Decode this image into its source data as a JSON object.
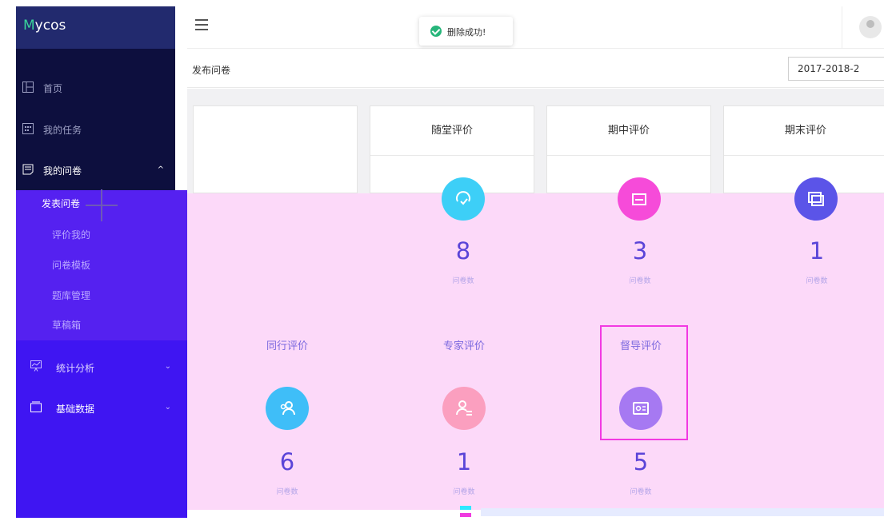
{
  "brand": {
    "first": "M",
    "rest": "ycos"
  },
  "sidebar": {
    "items": [
      {
        "label": "首页",
        "icon": "grid-icon"
      },
      {
        "label": "我的任务",
        "icon": "calendar-icon"
      },
      {
        "label": "我的问卷",
        "icon": "document-icon",
        "caret": "^"
      }
    ],
    "submenu": [
      {
        "label": "发表问卷"
      },
      {
        "label": "评价我的"
      },
      {
        "label": "问卷模板"
      },
      {
        "label": "题库管理"
      },
      {
        "label": "草稿箱"
      }
    ],
    "lower": [
      {
        "label": "统计分析",
        "icon": "chart-icon",
        "caret": "⌄"
      },
      {
        "label": "基础数据",
        "icon": "database-icon",
        "caret": "⌄"
      }
    ]
  },
  "header": {
    "toast": "删除成功!"
  },
  "breadcrumb": "发布问卷",
  "term": "2017-2018-2",
  "cards": [
    {
      "title": "随堂评价",
      "count": "8",
      "sub": "问卷数",
      "color": "#3dcff7"
    },
    {
      "title": "期中评价",
      "count": "3",
      "sub": "问卷数",
      "color": "#f64bd9"
    },
    {
      "title": "期末评价",
      "count": "1",
      "sub": "问卷数",
      "color": "#5b54e8"
    },
    {
      "title": "同行评价",
      "count": "6",
      "sub": "问卷数",
      "color": "#3fbef8"
    },
    {
      "title": "专家评价",
      "count": "1",
      "sub": "问卷数",
      "color": "#fb9fbf"
    },
    {
      "title": "督导评价",
      "count": "5",
      "sub": "问卷数",
      "color": "#a679f2"
    }
  ]
}
